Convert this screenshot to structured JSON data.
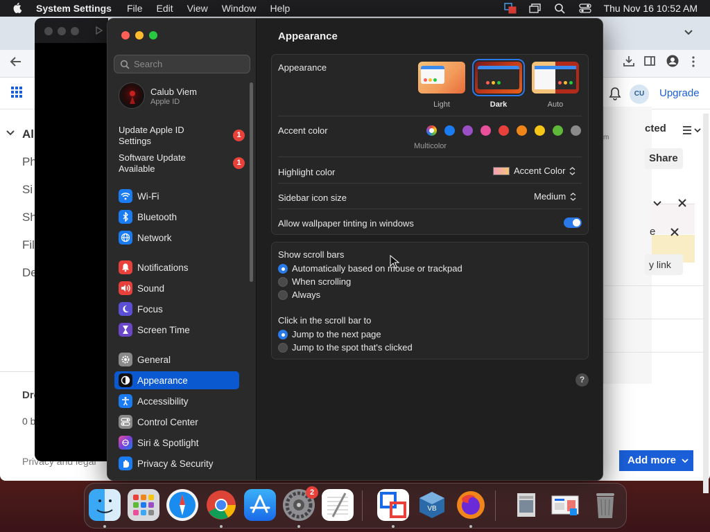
{
  "menubar": {
    "app_name": "System Settings",
    "menus": [
      "File",
      "Edit",
      "View",
      "Window",
      "Help"
    ],
    "clock": "Thu Nov 16  10:52 AM"
  },
  "background_browser": {
    "upgrade_label": "Upgrade",
    "account_initials": "CU",
    "add_more_label": "Add more",
    "fragments": [
      "All",
      "Ph",
      "Si",
      "Sh",
      "Fil",
      "De",
      "Dro",
      "0 b",
      "Privacy and legal",
      "cted",
      "Share",
      "e",
      "y link",
      "m"
    ]
  },
  "window": {
    "search_placeholder": "Search",
    "account": {
      "name": "Calub Viem",
      "subtitle": "Apple ID"
    },
    "notices": [
      {
        "label": "Update Apple ID Settings",
        "badge": "1"
      },
      {
        "label": "Software Update Available",
        "badge": "1"
      }
    ],
    "sidebar_items": [
      {
        "label": "Wi-Fi",
        "icon": "wifi-icon",
        "color": "#1a7cf0"
      },
      {
        "label": "Bluetooth",
        "icon": "bluetooth-icon",
        "color": "#1a7cf0"
      },
      {
        "label": "Network",
        "icon": "globe-icon",
        "color": "#1a7cf0"
      },
      {
        "label": "Notifications",
        "icon": "bell-icon",
        "color": "#e8413b"
      },
      {
        "label": "Sound",
        "icon": "speaker-icon",
        "color": "#e8413b"
      },
      {
        "label": "Focus",
        "icon": "moon-icon",
        "color": "#5b4fd6"
      },
      {
        "label": "Screen Time",
        "icon": "hourglass-icon",
        "color": "#6a47c8"
      },
      {
        "label": "General",
        "icon": "gear-icon",
        "color": "#8a8a8a"
      },
      {
        "label": "Appearance",
        "icon": "appearance-icon",
        "color": "#111111"
      },
      {
        "label": "Accessibility",
        "icon": "accessibility-icon",
        "color": "#1a7cf0"
      },
      {
        "label": "Control Center",
        "icon": "control-center-icon",
        "color": "#8a8a8a"
      },
      {
        "label": "Siri & Spotlight",
        "icon": "siri-icon",
        "color": "#b23bd8"
      },
      {
        "label": "Privacy & Security",
        "icon": "hand-icon",
        "color": "#1a7cf0"
      }
    ],
    "selected_item": "Appearance"
  },
  "appearance": {
    "page_title": "Appearance",
    "appearance_label": "Appearance",
    "themes": [
      {
        "label": "Light",
        "selected": false
      },
      {
        "label": "Dark",
        "selected": true
      },
      {
        "label": "Auto",
        "selected": false
      }
    ],
    "accent_label": "Accent color",
    "accent_colors": [
      "multicolor",
      "#1a7cf0",
      "#9b4fc4",
      "#e8509c",
      "#e8413b",
      "#f0861a",
      "#f5c518",
      "#5fb83a",
      "#8a8a8a"
    ],
    "accent_selected_label": "Multicolor",
    "highlight_label": "Highlight color",
    "highlight_value": "Accent Color",
    "icon_size_label": "Sidebar icon size",
    "icon_size_value": "Medium",
    "tinting_label": "Allow wallpaper tinting in windows",
    "tinting_on": true,
    "scrollbars_label": "Show scroll bars",
    "scrollbar_options": [
      {
        "label": "Automatically based on mouse or trackpad",
        "selected": true
      },
      {
        "label": "When scrolling",
        "selected": false
      },
      {
        "label": "Always",
        "selected": false
      }
    ],
    "click_label": "Click in the scroll bar to",
    "click_options": [
      {
        "label": "Jump to the next page",
        "selected": true
      },
      {
        "label": "Jump to the spot that's clicked",
        "selected": false
      }
    ],
    "help_label": "?"
  },
  "dock": {
    "apps": [
      "Finder",
      "Launchpad",
      "Safari",
      "Chrome",
      "App Store",
      "System Settings",
      "TextEdit",
      "Remote Desktop",
      "VirtualBox",
      "Firefox",
      "Preview",
      "Documents",
      "Trash"
    ],
    "settings_badge": "2"
  }
}
